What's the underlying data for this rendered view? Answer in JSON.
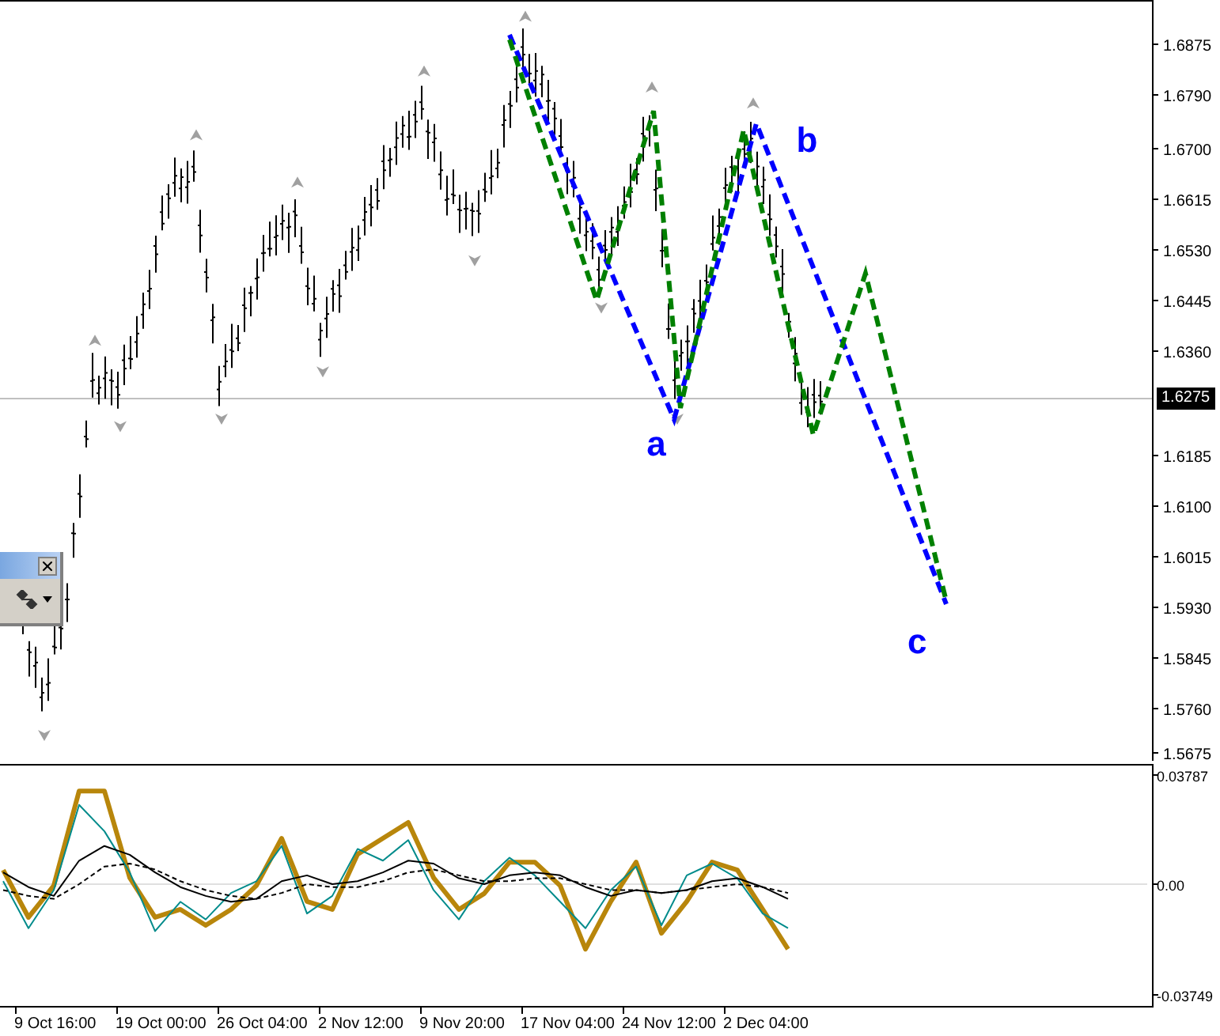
{
  "price_chart": {
    "current_price": "1.6275",
    "price_scale": [
      "1.6875",
      "1.6790",
      "1.6700",
      "1.6615",
      "1.6530",
      "1.6445",
      "1.6360",
      "1.6185",
      "1.6100",
      "1.6015",
      "1.5930",
      "1.5845",
      "1.5760",
      "1.5675"
    ],
    "wave_labels": [
      "a",
      "b",
      "c"
    ]
  },
  "oscillator": {
    "scale": [
      "0.03787",
      "0.00",
      "-0.03749"
    ]
  },
  "time_scale": [
    "9 Oct 16:00",
    "19 Oct 00:00",
    "26 Oct 04:00",
    "2 Nov 12:00",
    "9 Nov 20:00",
    "17 Nov 04:00",
    "24 Nov 12:00",
    "2 Dec 04:00"
  ]
}
